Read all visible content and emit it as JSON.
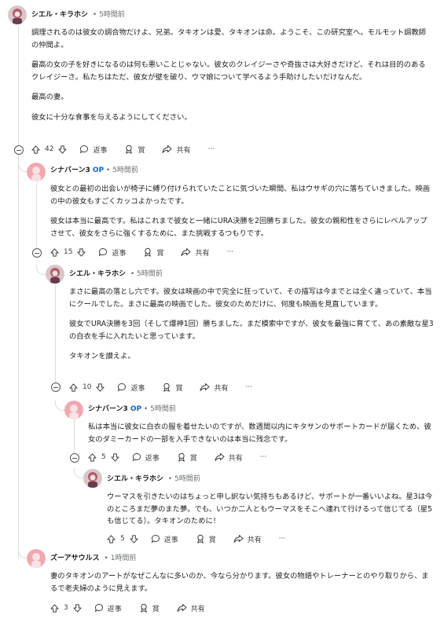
{
  "comments": [
    {
      "author": "シエル・キラホシ",
      "op": "",
      "time": "5時間前",
      "paragraphs": [
        "調理されるのは彼女の調合物だけよ、兄弟。タキオンは愛、タキオンは命。ようこそ、この研究室へ。モルモット調教師の仲間よ。",
        "最高の女の子を好きになるのは何も悪いことじゃない。彼女のクレイジーさや奇抜さは大好きだけど、それは目的のあるクレイジーさ。私たちはただ、彼女が壁を破り、ウマ娘について学べるよう手助けしたいだけなんだ。",
        "最高の妻。",
        "彼女に十分な食事を与えるようにしてください。"
      ],
      "votes": "42",
      "reply": "返事",
      "award": "賞",
      "share": "共有",
      "more": "···"
    },
    {
      "author": "シナバーン3",
      "op": "OP",
      "time": "5時間前",
      "paragraphs": [
        "彼女との最初の出会いが椅子に縛り付けられていたことに気づいた瞬間、私はウサギの穴に落ちていきました。映画の中の彼女もすごくカッコよかったです。",
        "彼女は本当に最高です。私はこれまで彼女と一緒にURA決勝を2回勝ちました。彼女の親和性をさらにレベルアップさせて、彼女をさらに強くするために、また挑戦するつもりです。"
      ],
      "votes": "15",
      "reply": "返事",
      "award": "賞",
      "share": "共有",
      "more": "···"
    },
    {
      "author": "シエル・キラホシ",
      "op": "",
      "time": "5時間前",
      "paragraphs": [
        "まさに最高の落とし穴です。彼女は映画の中で完全に狂っていて、その描写は今までとは全く違っていて、本当にクールでした。まさに最高の映画でした。彼女のためだけに、何度も映画を見直しています。",
        "彼女でURA決勝を3回（そして爆神1回）勝ちました。まだ模索中ですが、彼女を最強に育てて、あの素敵な星3の白衣を手に入れたいと思っています。",
        "タキオンを讃えよ。"
      ],
      "votes": "10",
      "reply": "返事",
      "award": "賞",
      "share": "共有",
      "more": "···"
    },
    {
      "author": "シナバーン3",
      "op": "OP",
      "time": "5時間前",
      "paragraphs": [
        "私は本当に彼女に白衣の服を着せたいのですが、数週間以内にキタサンのサポートカードが届くため、彼女のダミーカードの一部を入手できないのは本当に残念です。"
      ],
      "votes": "5",
      "reply": "返事",
      "award": "賞",
      "share": "共有",
      "more": "···"
    },
    {
      "author": "シエル・キラホシ",
      "op": "",
      "time": "5時間前",
      "paragraphs": [
        "ウーマスを引きたいのはちょっと申し訳ない気持ちもあるけど、サポートが一番いいよね。星3は今のところまだ夢のまた夢。でも、いつか二人ともウーマスをそこへ連れて行けるって信じてる（星5も信じてる）。タキオンのために！"
      ],
      "votes": "5",
      "reply": "返事",
      "award": "賞",
      "share": "共有",
      "more": "···"
    },
    {
      "author": "ズーアサウルス",
      "op": "",
      "time": "1時間前",
      "paragraphs": [
        "妻のタキオンのアートがなぜこんなに多いのか、今なら分かります。彼女の物語やトレーナーとのやり取りから、まるで老夫婦のように見えます。"
      ],
      "votes": "3",
      "reply": "返事",
      "award": "賞",
      "share": "共有",
      "more": "···"
    }
  ],
  "colors": {
    "op": "#0a66d8",
    "meta": "#6b6f73",
    "thread_line": "#dcdcdc"
  },
  "icons": [
    "upvote-icon",
    "downvote-icon",
    "reply-icon",
    "award-icon",
    "share-icon",
    "collapse-icon"
  ]
}
